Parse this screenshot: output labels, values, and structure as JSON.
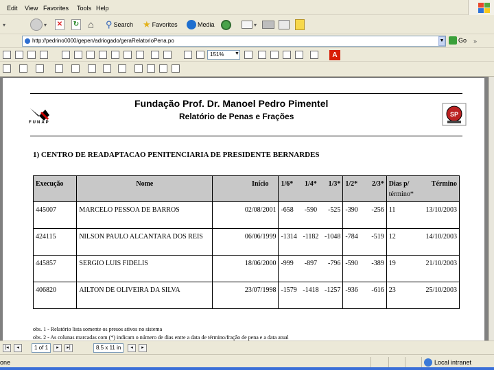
{
  "menu": {
    "items": [
      "Edit",
      "View",
      "Favorites",
      "Tools",
      "Help"
    ]
  },
  "toolbar": {
    "search_label": "Search",
    "favorites_label": "Favorites",
    "media_label": "Media",
    "go_label": "Go"
  },
  "address": {
    "url": "http://pedrino0000/gepen/adriogado/geraRelatorioPena.po"
  },
  "acrobat": {
    "zoom": "151%",
    "page_box": "1 of 1",
    "size_box": "8.5 x 11 in"
  },
  "document": {
    "org_title": "Fundação Prof. Dr. Manoel Pedro Pimentel",
    "subtitle": "Relatório de Penas e Frações",
    "logo_text": "FUNAP",
    "seal_text": "SP",
    "section": "1) CENTRO DE READAPTACAO PENITENCIARIA DE PRESIDENTE BERNARDES",
    "table": {
      "headers": {
        "execucao": "Execução",
        "nome": "Nome",
        "inicio": "Início",
        "f16": "1/6*",
        "f14": "1/4*",
        "f13": "1/3*",
        "f12": "1/2*",
        "f23": "2/3*",
        "dias": "Dias p/",
        "termino": "Término",
        "termino2": "término*"
      },
      "rows": [
        {
          "execucao": "445007",
          "nome": "MARCELO PESSOA DE BARROS",
          "inicio": "02/08/2001",
          "f16": "-658",
          "f14": "-590",
          "f13": "-525",
          "f12": "-390",
          "f23": "-256",
          "dias": "11",
          "termino": "13/10/2003"
        },
        {
          "execucao": "424115",
          "nome": "NILSON PAULO ALCANTARA DOS REIS",
          "inicio": "06/06/1999",
          "f16": "-1314",
          "f14": "-1182",
          "f13": "-1048",
          "f12": "-784",
          "f23": "-519",
          "dias": "12",
          "termino": "14/10/2003"
        },
        {
          "execucao": "445857",
          "nome": "SERGIO LUIS FIDELIS",
          "inicio": "18/06/2000",
          "f16": "-999",
          "f14": "-897",
          "f13": "-796",
          "f12": "-590",
          "f23": "-389",
          "dias": "19",
          "termino": "21/10/2003"
        },
        {
          "execucao": "406820",
          "nome": "AILTON DE OLIVEIRA DA SILVA",
          "inicio": "23/07/1998",
          "f16": "-1579",
          "f14": "-1418",
          "f13": "-1257",
          "f12": "-936",
          "f23": "-616",
          "dias": "23",
          "termino": "25/10/2003"
        }
      ]
    },
    "obs1": "obs. 1 - Relatório lista somente os presos ativos no sistema",
    "obs2": "obs. 2 - As colunas marcadas com (*) indicam o número de dias entre a data de término/fração de pena e a data atual"
  },
  "status": {
    "left": "one",
    "zone": "Local intranet"
  },
  "colors": {
    "chrome": "#ece9d8",
    "table_header": "#c8c8c8",
    "viewer_bg": "#808080",
    "adobe_red": "#d81e05"
  }
}
